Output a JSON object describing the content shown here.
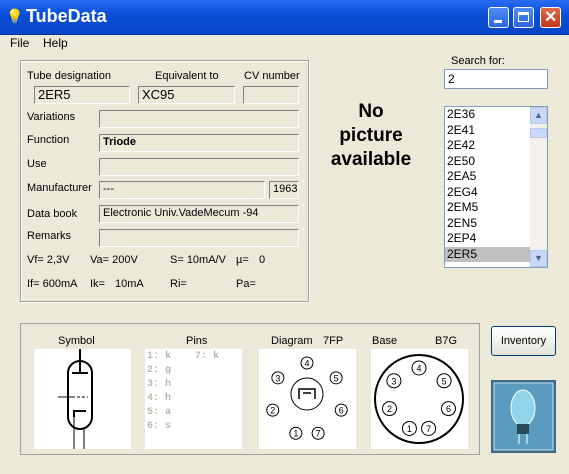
{
  "window": {
    "title": "TubeData"
  },
  "menu": {
    "file": "File",
    "help": "Help"
  },
  "fields": {
    "tube_designation_label": "Tube designation",
    "equivalent_label": "Equivalent to",
    "cv_label": "CV number",
    "tube_designation": "2ER5",
    "equivalent": "XC95",
    "cv_number": "",
    "variations_label": "Variations",
    "variations": "",
    "function_label": "Function",
    "function": "Triode",
    "use_label": "Use",
    "use": "",
    "manufacturer_label": "Manufacturer",
    "manufacturer": "---",
    "year": "1963",
    "databook_label": "Data book",
    "databook": "Electronic Univ.VadeMecum -94",
    "remarks_label": "Remarks",
    "remarks": ""
  },
  "params": {
    "vf": "Vf= 2,3V",
    "va": "Va= 200V",
    "s": "S= 10mA/V",
    "mu": "µ=",
    "mu_val": "0",
    "if": "If= 600mA",
    "ik": "Ik=",
    "ik_val": "10mA",
    "ri": "Ri=",
    "pa": "Pa="
  },
  "picture": {
    "line1": "No",
    "line2": "picture",
    "line3": "available"
  },
  "search": {
    "label": "Search for:",
    "value": "2"
  },
  "list": [
    "2E36",
    "2E41",
    "2E42",
    "2E50",
    "2EA5",
    "2EG4",
    "2EM5",
    "2EN5",
    "2EP4",
    "2ER5"
  ],
  "selected": "2ER5",
  "bottom": {
    "symbol": "Symbol",
    "pins": "Pins",
    "diagram": "Diagram",
    "diagram_code": "7FP",
    "base": "Base",
    "base_code": "B7G",
    "pin_list_left": [
      "1: k",
      "2: g",
      "3: h",
      "4: h",
      "5: a",
      "6: s"
    ],
    "pin_list_right": [
      "7: k"
    ]
  },
  "inventory": "Inventory",
  "diagram_pins": [
    "1",
    "2",
    "3",
    "4",
    "5",
    "6",
    "7"
  ],
  "base_pins": [
    "1",
    "2",
    "3",
    "4",
    "5",
    "6",
    "7"
  ]
}
